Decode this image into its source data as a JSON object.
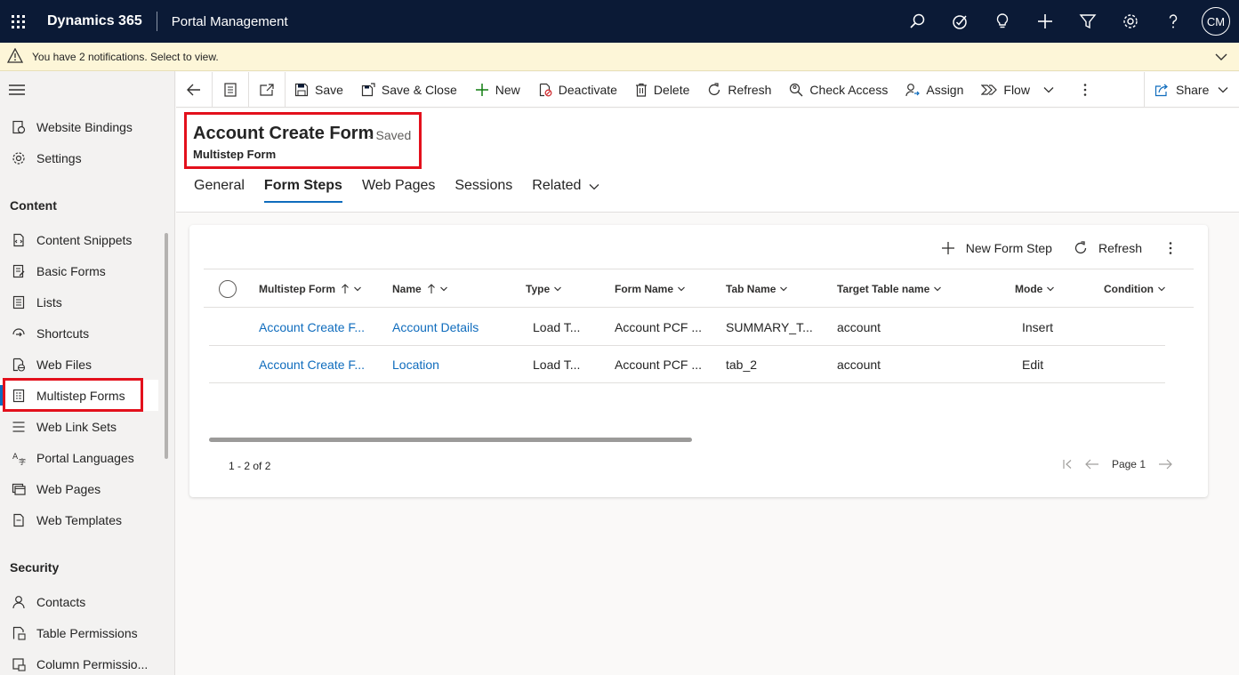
{
  "topbar": {
    "app_name": "Dynamics 365",
    "module_name": "Portal Management",
    "avatar_initials": "CM",
    "bg_color": "#0b1a36"
  },
  "notification": {
    "text": "You have 2 notifications. Select to view."
  },
  "sidebar": {
    "top_items": [
      {
        "label": "Website Bindings",
        "icon": "website-bindings-icon"
      },
      {
        "label": "Settings",
        "icon": "gear-icon"
      }
    ],
    "groups": [
      {
        "title": "Content",
        "items": [
          {
            "label": "Content Snippets",
            "icon": "snippet-icon"
          },
          {
            "label": "Basic Forms",
            "icon": "form-icon"
          },
          {
            "label": "Lists",
            "icon": "list-icon"
          },
          {
            "label": "Shortcuts",
            "icon": "shortcut-icon"
          },
          {
            "label": "Web Files",
            "icon": "web-file-icon"
          },
          {
            "label": "Multistep Forms",
            "icon": "multistep-form-icon",
            "selected": true
          },
          {
            "label": "Web Link Sets",
            "icon": "link-set-icon"
          },
          {
            "label": "Portal Languages",
            "icon": "language-icon"
          },
          {
            "label": "Web Pages",
            "icon": "web-page-icon"
          },
          {
            "label": "Web Templates",
            "icon": "template-icon"
          }
        ]
      },
      {
        "title": "Security",
        "items": [
          {
            "label": "Contacts",
            "icon": "person-icon"
          },
          {
            "label": "Table Permissions",
            "icon": "table-permission-icon"
          },
          {
            "label": "Column Permissio...",
            "icon": "column-permission-icon"
          }
        ]
      }
    ]
  },
  "commandbar": {
    "save": "Save",
    "save_close": "Save & Close",
    "new": "New",
    "deactivate": "Deactivate",
    "delete": "Delete",
    "refresh": "Refresh",
    "check_access": "Check Access",
    "assign": "Assign",
    "flow": "Flow",
    "share": "Share"
  },
  "record": {
    "title": "Account Create Form",
    "status": "- Saved",
    "entity": "Multistep Form"
  },
  "tabs": [
    {
      "label": "General",
      "active": false
    },
    {
      "label": "Form Steps",
      "active": true
    },
    {
      "label": "Web Pages",
      "active": false
    },
    {
      "label": "Sessions",
      "active": false
    },
    {
      "label": "Related",
      "active": false
    }
  ],
  "grid": {
    "new_step": "New Form Step",
    "refresh": "Refresh",
    "columns": [
      "Multistep Form",
      "Name",
      "Type",
      "Form Name",
      "Tab Name",
      "Target Table name",
      "Mode",
      "Condition"
    ],
    "rows": [
      [
        "Account Create F...",
        "Account Details",
        "Load T...",
        "Account PCF ...",
        "SUMMARY_T...",
        "account",
        "Insert",
        ""
      ],
      [
        "Account Create F...",
        "Location",
        "Load T...",
        "Account PCF ...",
        "tab_2",
        "account",
        "Edit",
        ""
      ]
    ],
    "count": "1 - 2 of 2",
    "page": "Page 1"
  }
}
